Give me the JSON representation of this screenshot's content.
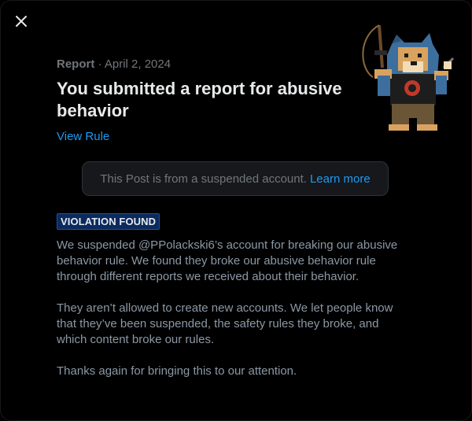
{
  "close_icon": "close-icon",
  "report": {
    "label": "Report",
    "separator": "·",
    "date": "April 2, 2024",
    "title": "You submitted a report for abusive behavior",
    "view_rule": "View Rule"
  },
  "notice": {
    "text": "This Post is from a suspended account.",
    "learn_more": "Learn more"
  },
  "badge": "VIOLATION FOUND",
  "body": {
    "p1": "We suspended @PPolackski6’s account for breaking our abusive behavior rule. We found they broke our abusive behavior rule through different reports we received about their behavior.",
    "p2": "They aren’t allowed to create new accounts. We let people know that they’ve been suspended, the safety rules they broke, and which content broke our rules.",
    "p3": "Thanks again for bringing this to our attention."
  },
  "colors": {
    "background": "#000000",
    "text_primary": "#e7e9ea",
    "text_secondary": "#71767b",
    "accent": "#1d9bf0",
    "badge_bg": "#0b2a5e"
  }
}
